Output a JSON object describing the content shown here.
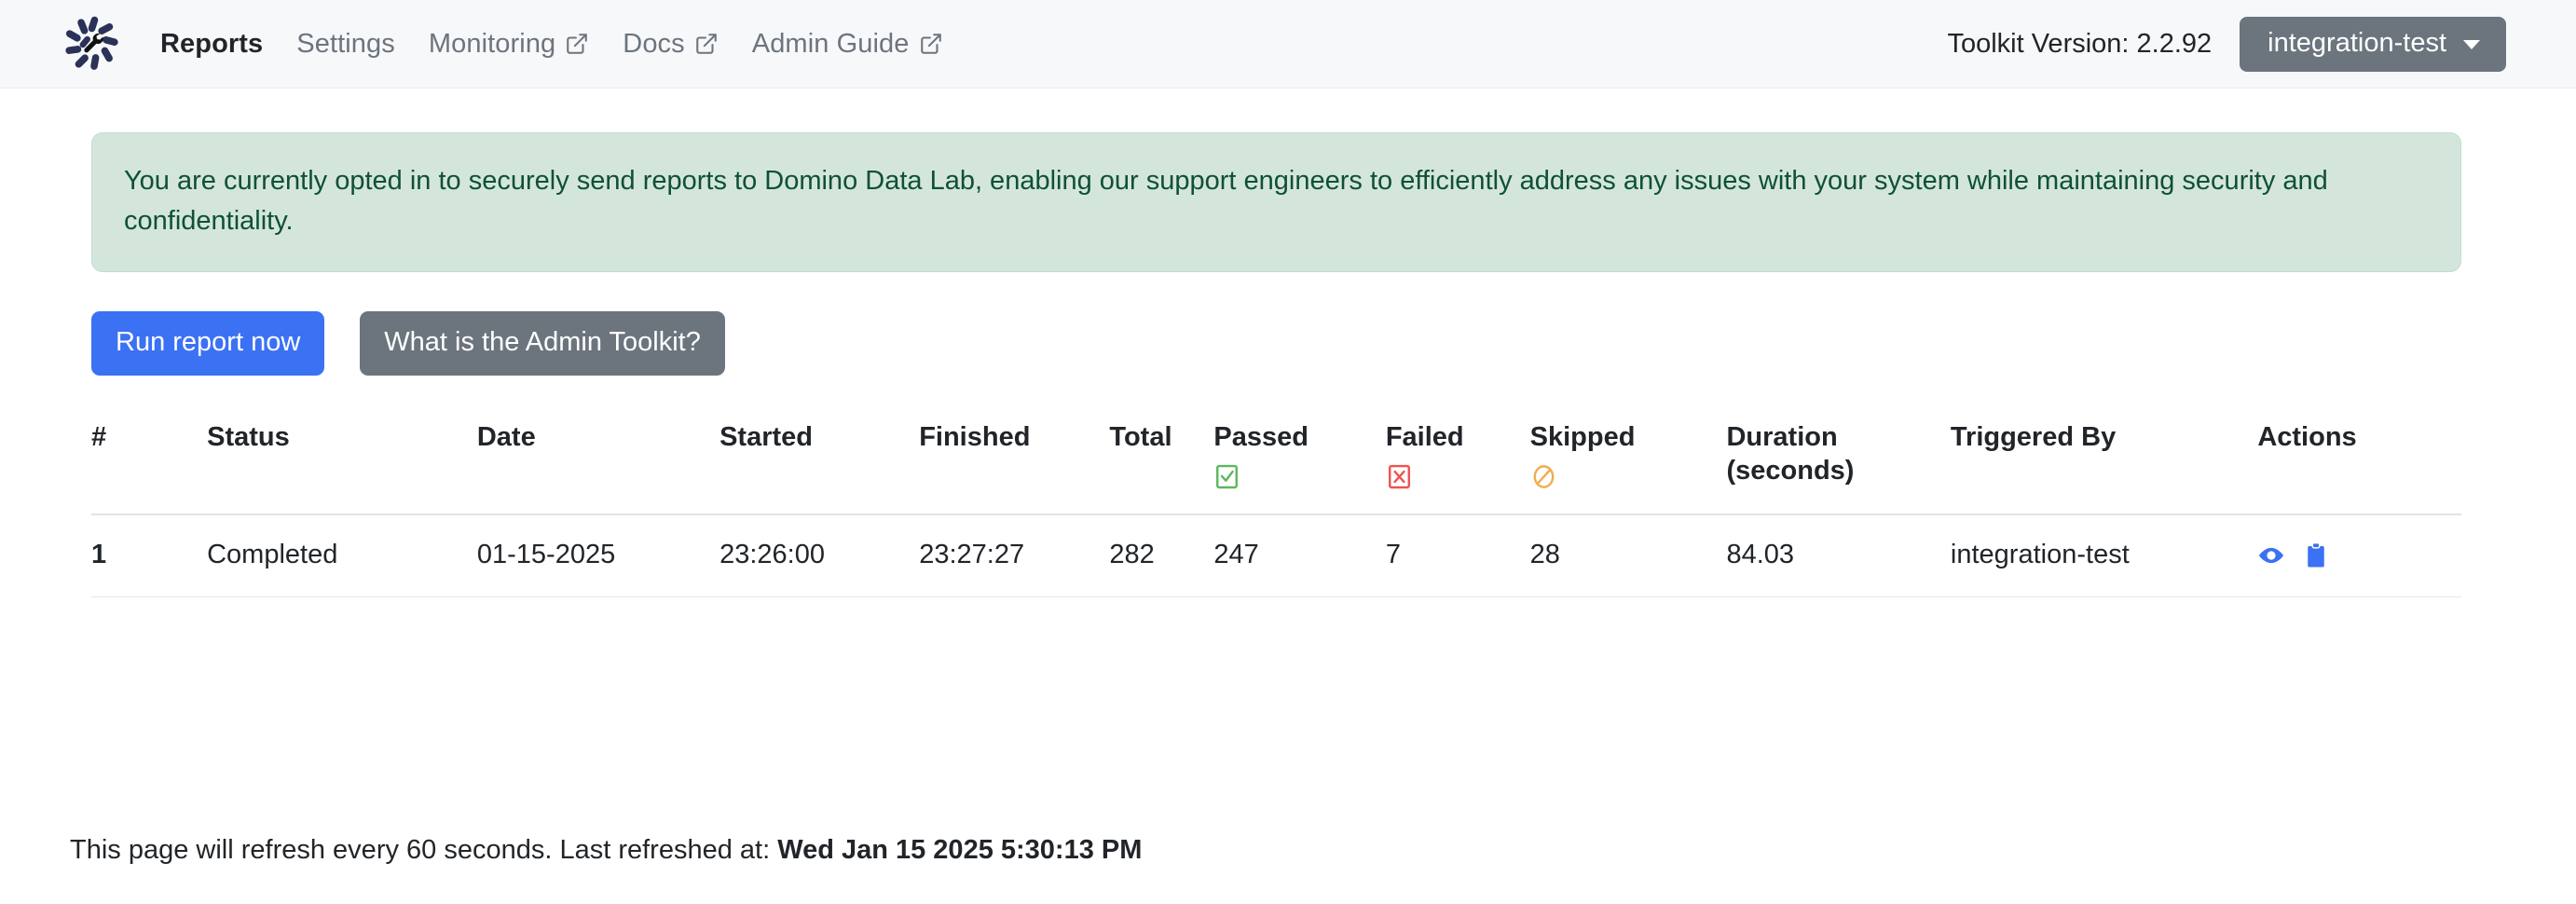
{
  "header": {
    "logo_name": "domino-admin-toolkit-logo",
    "nav": [
      {
        "label": "Reports",
        "active": true,
        "external": false
      },
      {
        "label": "Settings",
        "active": false,
        "external": false
      },
      {
        "label": "Monitoring",
        "active": false,
        "external": true
      },
      {
        "label": "Docs",
        "active": false,
        "external": true
      },
      {
        "label": "Admin Guide",
        "active": false,
        "external": true
      }
    ],
    "version_label": "Toolkit Version: 2.2.92",
    "user_dropdown_label": "integration-test"
  },
  "alert": {
    "message": "You are currently opted in to securely send reports to Domino Data Lab, enabling our support engineers to efficiently address any issues with your system while maintaining security and confidentiality.",
    "background_color": "#d4e6dc",
    "text_color": "#0f5132"
  },
  "buttons": {
    "run_report_label": "Run report now",
    "what_is_toolkit_label": "What is the Admin Toolkit?",
    "primary_color": "#3b71f3",
    "secondary_color": "#6c757d"
  },
  "table": {
    "columns": [
      {
        "label": "#",
        "icon": null
      },
      {
        "label": "Status",
        "icon": null
      },
      {
        "label": "Date",
        "icon": null
      },
      {
        "label": "Started",
        "icon": null
      },
      {
        "label": "Finished",
        "icon": null
      },
      {
        "label": "Total",
        "icon": null
      },
      {
        "label": "Passed",
        "icon": "check-box-icon"
      },
      {
        "label": "Failed",
        "icon": "x-box-icon"
      },
      {
        "label": "Skipped",
        "icon": "no-entry-icon"
      },
      {
        "label": "Duration (seconds)",
        "icon": null
      },
      {
        "label": "Triggered By",
        "icon": null
      },
      {
        "label": "Actions",
        "icon": null
      }
    ],
    "rows": [
      {
        "index": "1",
        "status": "Completed",
        "date": "01-15-2025",
        "started": "23:26:00",
        "finished": "23:27:27",
        "total": "282",
        "passed": "247",
        "failed": "7",
        "skipped": "28",
        "duration": "84.03",
        "triggered_by": "integration-test",
        "actions": [
          "view-report-icon",
          "copy-report-icon"
        ]
      }
    ],
    "icon_colors": {
      "passed": "#5cb85c",
      "failed": "#ef5350",
      "skipped": "#f0ad4e",
      "action": "#3b71f3"
    }
  },
  "footer": {
    "text": "This page will refresh every 60 seconds. Last refreshed at: ",
    "timestamp": "Wed Jan 15 2025 5:30:13 PM"
  }
}
